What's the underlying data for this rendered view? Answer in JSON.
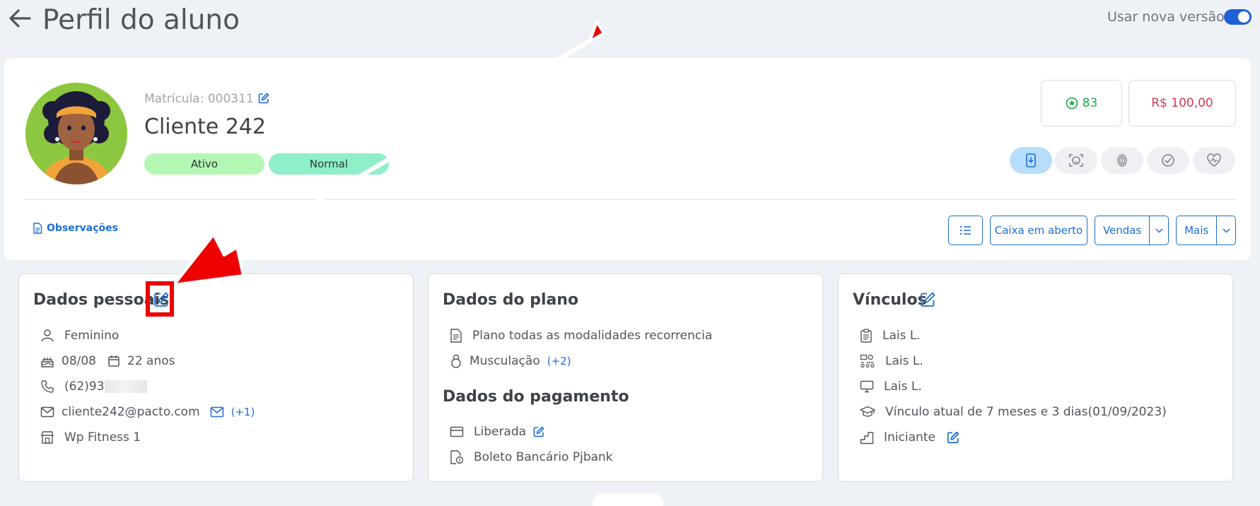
{
  "header": {
    "title": "Perfil do aluno",
    "new_version_label": "Usar nova versão",
    "new_version_on": true
  },
  "profile": {
    "matricula": "Matrícula: 000311",
    "name": "Cliente 242",
    "badges": [
      "Ativo",
      "Normal"
    ],
    "points": "83",
    "balance": "R$ 100,00",
    "observacoes": "Observações"
  },
  "actions": {
    "caixa": "Caixa em aberto",
    "vendas": "Vendas",
    "mais": "Mais"
  },
  "personal": {
    "title": "Dados pessoais",
    "gender": "Feminino",
    "birthday": "08/08",
    "age": "22 anos",
    "phone": "(62)93",
    "email": "cliente242@pacto.com",
    "email_more": "(+1)",
    "unit": "Wp Fitness 1"
  },
  "plan": {
    "title": "Dados do plano",
    "plan_name": "Plano todas as modalidades recorrencia",
    "modality": "Musculação",
    "modality_more": "(+2)"
  },
  "payment": {
    "title": "Dados do pagamento",
    "status": "Liberada",
    "method": "Boleto Bancário Pjbank"
  },
  "links": {
    "title": "Vínculos",
    "consultant": "Lais L.",
    "trainer": "Lais L.",
    "professor": "Lais L.",
    "tenure": "Vínculo atual de 7 meses e 3 dias(01/09/2023)",
    "level": "Iniciante"
  },
  "colors": {
    "accent": "#1e6ed6",
    "toggle": "#1e60d6",
    "points": "#1ea94b",
    "balance": "#d63950",
    "badge_ativo": "#b4f7b4",
    "badge_normal": "#8fefc9",
    "annotation": "#ee0000"
  }
}
